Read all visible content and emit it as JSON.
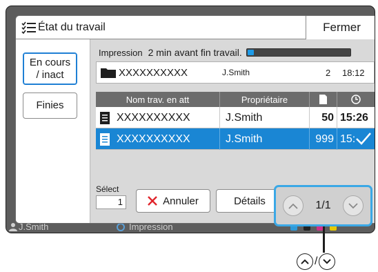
{
  "window": {
    "title": "État du travail",
    "close_label": "Fermer"
  },
  "tabs": [
    {
      "label_line1": "En cours",
      "label_line2": "/ inact"
    },
    {
      "label": "Finies"
    }
  ],
  "current_job": {
    "status_label": "Impression",
    "status_text": "2 min avant fin travail.",
    "progress_fraction": 0.04,
    "name": "XXXXXXXXXX",
    "owner": "J.Smith",
    "copies": "2",
    "time": "18:12",
    "icon": "folder-icon"
  },
  "table": {
    "headers": {
      "name": "Nom trav. en att",
      "owner": "Propriétaire",
      "copies_icon": "document-icon",
      "time_icon": "clock-icon"
    },
    "rows": [
      {
        "name": "XXXXXXXXXX",
        "owner": "J.Smith",
        "copies": "50",
        "time": "15:26",
        "selected": false,
        "icon": "document-icon"
      },
      {
        "name": "XXXXXXXXXX",
        "owner": "J.Smith",
        "copies": "999",
        "time": "15:",
        "selected": true,
        "icon": "document-icon"
      }
    ]
  },
  "footer": {
    "select_label": "Sélect",
    "select_count": "1",
    "cancel_label": "Annuler",
    "details_label": "Détails",
    "page_indicator": "1/1"
  },
  "status_bar": {
    "user": "J.Smith",
    "mode": "Impression"
  },
  "legend": {
    "separator": "/"
  },
  "colors": {
    "accent": "#1a86d4",
    "highlight": "#3aa8e6",
    "header": "#6c6c6c",
    "cancel_x": "#e0242b"
  }
}
